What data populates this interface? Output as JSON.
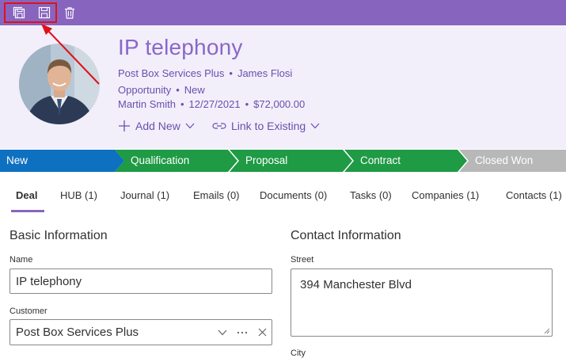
{
  "toolbar": {
    "icons": [
      "save-and-close-icon",
      "save-icon",
      "delete-icon"
    ],
    "color": "#8765bf",
    "highlight_color": "#e0111b"
  },
  "record": {
    "title": "IP telephony",
    "company": "Post Box Services Plus",
    "contact": "James Flosi",
    "type": "Opportunity",
    "status": "New",
    "owner": "Martin Smith",
    "date": "12/27/2021",
    "amount": "$72,000.00"
  },
  "actions": {
    "add_new": "Add New",
    "link_existing": "Link to Existing"
  },
  "stages": [
    {
      "label": "New",
      "color": "#0e70c0"
    },
    {
      "label": "Qualification",
      "color": "#1f9a45"
    },
    {
      "label": "Proposal",
      "color": "#1f9a45"
    },
    {
      "label": "Contract",
      "color": "#1f9a45"
    },
    {
      "label": "Closed Won",
      "color": "#b8b8b8"
    }
  ],
  "tabs": {
    "deal": "Deal",
    "hub": "HUB (1)",
    "journal": "Journal (1)",
    "emails": "Emails (0)",
    "documents": "Documents (0)",
    "tasks": "Tasks (0)",
    "companies": "Companies (1)",
    "contacts": "Contacts (1)"
  },
  "basic": {
    "title": "Basic Information",
    "name_label": "Name",
    "name_value": "IP telephony",
    "customer_label": "Customer",
    "customer_value": "Post Box Services Plus"
  },
  "contact_info": {
    "title": "Contact Information",
    "street_label": "Street",
    "street_value": "394 Manchester Blvd",
    "city_label": "City"
  }
}
